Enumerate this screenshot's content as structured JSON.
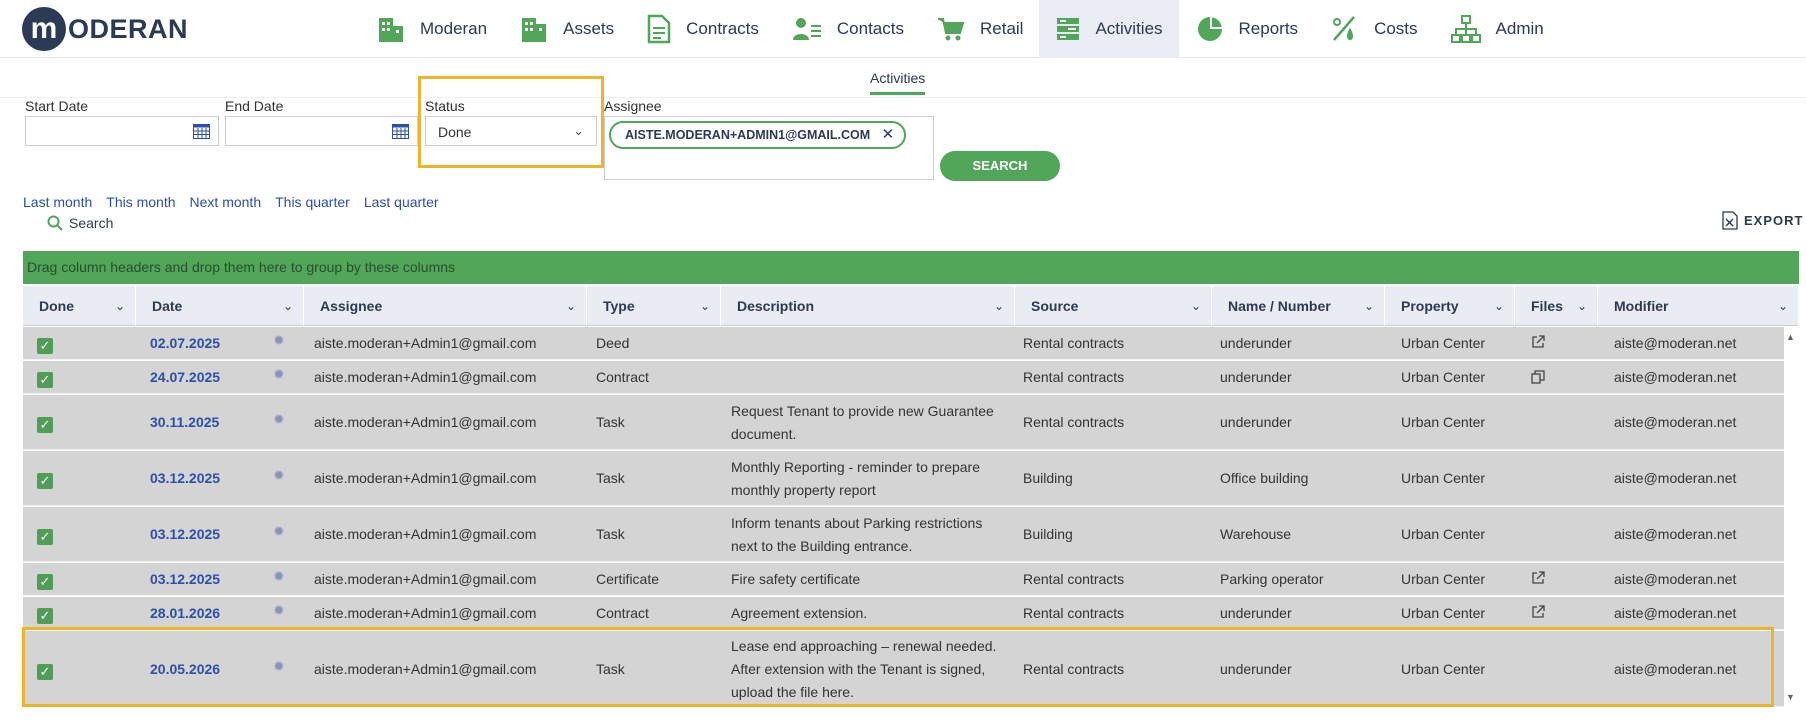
{
  "app": {
    "logo_letter": "m",
    "logo_text": "ODERAN"
  },
  "nav": [
    {
      "label": "Moderan",
      "icon": "building-icon"
    },
    {
      "label": "Assets",
      "icon": "buildings-icon"
    },
    {
      "label": "Contracts",
      "icon": "document-icon"
    },
    {
      "label": "Contacts",
      "icon": "contact-card-icon"
    },
    {
      "label": "Retail",
      "icon": "cart-icon"
    },
    {
      "label": "Activities",
      "icon": "server-list-icon",
      "active": true
    },
    {
      "label": "Reports",
      "icon": "pie-chart-icon"
    },
    {
      "label": "Costs",
      "icon": "percent-drop-icon"
    },
    {
      "label": "Admin",
      "icon": "org-chart-icon"
    }
  ],
  "subnav": {
    "active_tab": "Activities"
  },
  "filters": {
    "start_date_label": "Start Date",
    "start_date_value": "",
    "end_date_label": "End Date",
    "end_date_value": "",
    "status_label": "Status",
    "status_value": "Done",
    "assignee_label": "Assignee",
    "assignee_chip": "AISTE.MODERAN+ADMIN1@GMAIL.COM",
    "search_button": "SEARCH"
  },
  "quick_links": [
    "Last month",
    "This month",
    "Next month",
    "This quarter",
    "Last quarter"
  ],
  "search_link": "Search",
  "export_label": "EXPORT",
  "group_bar": "Drag column headers and drop them here to group by these columns",
  "columns": [
    "Done",
    "Date",
    "Assignee",
    "Type",
    "Description",
    "Source",
    "Name / Number",
    "Property",
    "Files",
    "Modifier"
  ],
  "rows": [
    {
      "date": "02.07.2025",
      "assignee": "aiste.moderan+Admin1@gmail.com",
      "type": "Deed",
      "description": [
        "",
        ""
      ],
      "source": "Rental contracts",
      "name": "underunder",
      "property": "Urban Center",
      "files": "external-link-icon",
      "modifier": "aiste@moderan.net"
    },
    {
      "date": "24.07.2025",
      "assignee": "aiste.moderan+Admin1@gmail.com",
      "type": "Contract",
      "description": [
        "",
        ""
      ],
      "source": "Rental contracts",
      "name": "underunder",
      "property": "Urban Center",
      "files": "copy-icon",
      "modifier": "aiste@moderan.net"
    },
    {
      "date": "30.11.2025",
      "assignee": "aiste.moderan+Admin1@gmail.com",
      "type": "Task",
      "description": [
        "Request Tenant to provide new Guarantee",
        "document."
      ],
      "source": "Rental contracts",
      "name": "underunder",
      "property": "Urban Center",
      "files": "",
      "modifier": "aiste@moderan.net"
    },
    {
      "date": "03.12.2025",
      "assignee": "aiste.moderan+Admin1@gmail.com",
      "type": "Task",
      "description": [
        "Monthly Reporting - reminder to prepare",
        "monthly property report"
      ],
      "source": "Building",
      "name": "Office building",
      "property": "Urban Center",
      "files": "",
      "modifier": "aiste@moderan.net"
    },
    {
      "date": "03.12.2025",
      "assignee": "aiste.moderan+Admin1@gmail.com",
      "type": "Task",
      "description": [
        "Inform tenants about Parking restrictions",
        "next to the Building entrance."
      ],
      "source": "Building",
      "name": "Warehouse",
      "property": "Urban Center",
      "files": "",
      "modifier": "aiste@moderan.net"
    },
    {
      "date": "03.12.2025",
      "assignee": "aiste.moderan+Admin1@gmail.com",
      "type": "Certificate",
      "description": [
        "Fire safety certificate",
        ""
      ],
      "source": "Rental contracts",
      "name": "Parking operator",
      "property": "Urban Center",
      "files": "external-link-icon",
      "modifier": "aiste@moderan.net"
    },
    {
      "date": "28.01.2026",
      "assignee": "aiste.moderan+Admin1@gmail.com",
      "type": "Contract",
      "description": [
        "Agreement extension.",
        ""
      ],
      "source": "Rental contracts",
      "name": "underunder",
      "property": "Urban Center",
      "files": "external-link-icon",
      "modifier": "aiste@moderan.net"
    },
    {
      "date": "20.05.2026",
      "assignee": "aiste.moderan+Admin1@gmail.com",
      "type": "Task",
      "description": [
        "Lease end approaching – renewal needed.",
        "After extension with the Tenant is signed,",
        "upload the file here."
      ],
      "source": "Rental contracts",
      "name": "underunder",
      "property": "Urban Center",
      "files": "",
      "modifier": "aiste@moderan.net"
    }
  ],
  "colors": {
    "green": "#52a65a",
    "navy": "#2b3a55",
    "highlight": "#f0b429",
    "row_bg": "#d4d4d4"
  }
}
